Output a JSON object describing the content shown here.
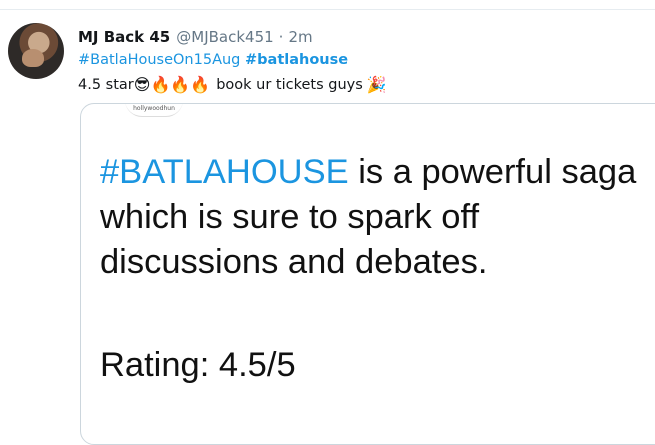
{
  "tweet": {
    "display_name": "MJ Back 45",
    "handle": "@MJBack451",
    "separator": "·",
    "time": "2m",
    "hashtag_1": "#BatlaHouseOn15Aug",
    "hashtag_2": "#batlahouse",
    "text_prefix": "4.5 star",
    "emoji_sunglasses": "😎",
    "emoji_fire_1": "🔥",
    "emoji_fire_2": "🔥",
    "emoji_fire_3": "🔥",
    "text_suffix": "book ur tickets guys",
    "emoji_party": "🎉",
    "avatar_icon": "user-avatar"
  },
  "card": {
    "logo_text": "hollywoodhun",
    "hashtag": "#BATLAHOUSE",
    "body": " is a powerful saga which is sure to spark off discussions and debates.",
    "rating": "Rating: 4.5/5"
  },
  "colors": {
    "link": "#1b95e0",
    "text": "#14171a",
    "muted": "#657786",
    "border": "#ccd6dd"
  }
}
